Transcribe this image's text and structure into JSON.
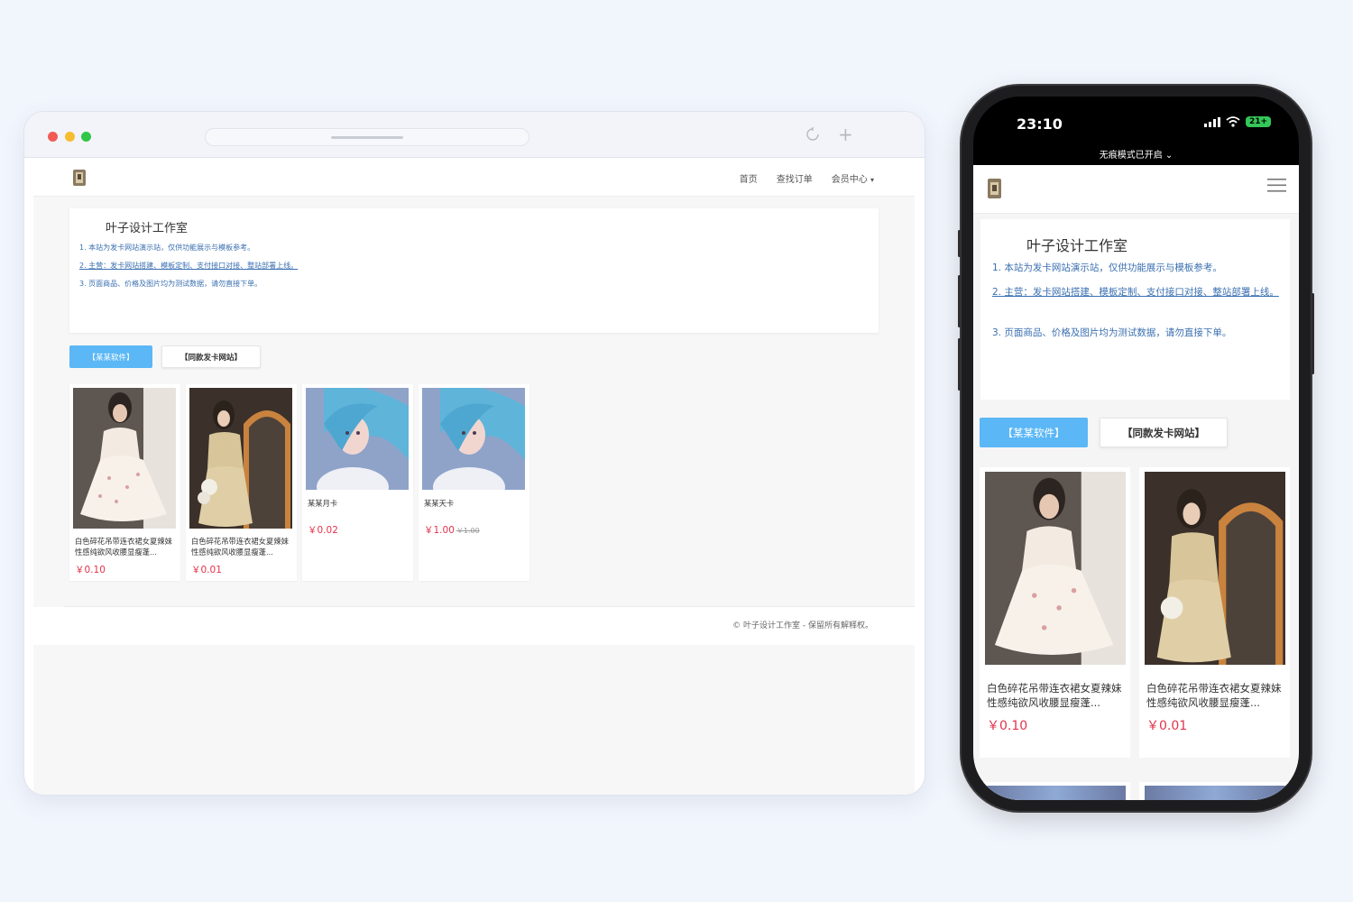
{
  "desktop": {
    "nav": {
      "links": [
        "首页",
        "查找订单",
        "会员中心"
      ],
      "caret": "▾"
    },
    "notice": {
      "title": "叶子设计工作室",
      "lines": [
        "1. 本站为发卡网站演示站，仅供功能展示与模板参考。",
        "2. 主营：发卡网站搭建、模板定制、支付接口对接、整站部署上线。",
        "3. 页面商品、价格及图片均为测试数据，请勿直接下单。"
      ]
    },
    "tabs": [
      "【某某软件】",
      "【同款发卡网站】"
    ],
    "products": [
      {
        "name": "白色碎花吊带连衣裙女夏辣妹性感纯欲风收腰显瘦蓬...",
        "price": "￥0.10"
      },
      {
        "name": "白色碎花吊带连衣裙女夏辣妹性感纯欲风收腰显瘦蓬...",
        "price": "￥0.01"
      },
      {
        "name": "某某月卡",
        "price": "￥0.02"
      },
      {
        "name": "某某天卡",
        "price": "￥1.00",
        "old_price": "￥1.00"
      }
    ],
    "footer": "© 叶子设计工作室 - 保留所有解释权。"
  },
  "mobile": {
    "status": {
      "time": "23:10",
      "battery": "21+"
    },
    "incognito": "无痕模式已开启 ⌄",
    "notice": {
      "title": "叶子设计工作室",
      "lines": [
        "1. 本站为发卡网站演示站，仅供功能展示与模板参考。",
        "2. 主营：发卡网站搭建、模板定制、支付接口对接、整站部署上线。",
        "3. 页面商品、价格及图片均为测试数据，请勿直接下单。"
      ]
    },
    "tabs": [
      "【某某软件】",
      "【同款发卡网站】"
    ],
    "products": [
      {
        "name": "白色碎花吊带连衣裙女夏辣妹性感纯欲风收腰显瘦蓬...",
        "price": "￥0.10"
      },
      {
        "name": "白色碎花吊带连衣裙女夏辣妹性感纯欲风收腰显瘦蓬...",
        "price": "￥0.01"
      }
    ]
  },
  "colors": {
    "accent": "#5bb7f6",
    "price": "#e2334a",
    "link": "#3a6fb0"
  },
  "icons": {
    "reload": "reload-icon",
    "new_tab": "plus-icon",
    "menu": "hamburger-menu-icon"
  }
}
